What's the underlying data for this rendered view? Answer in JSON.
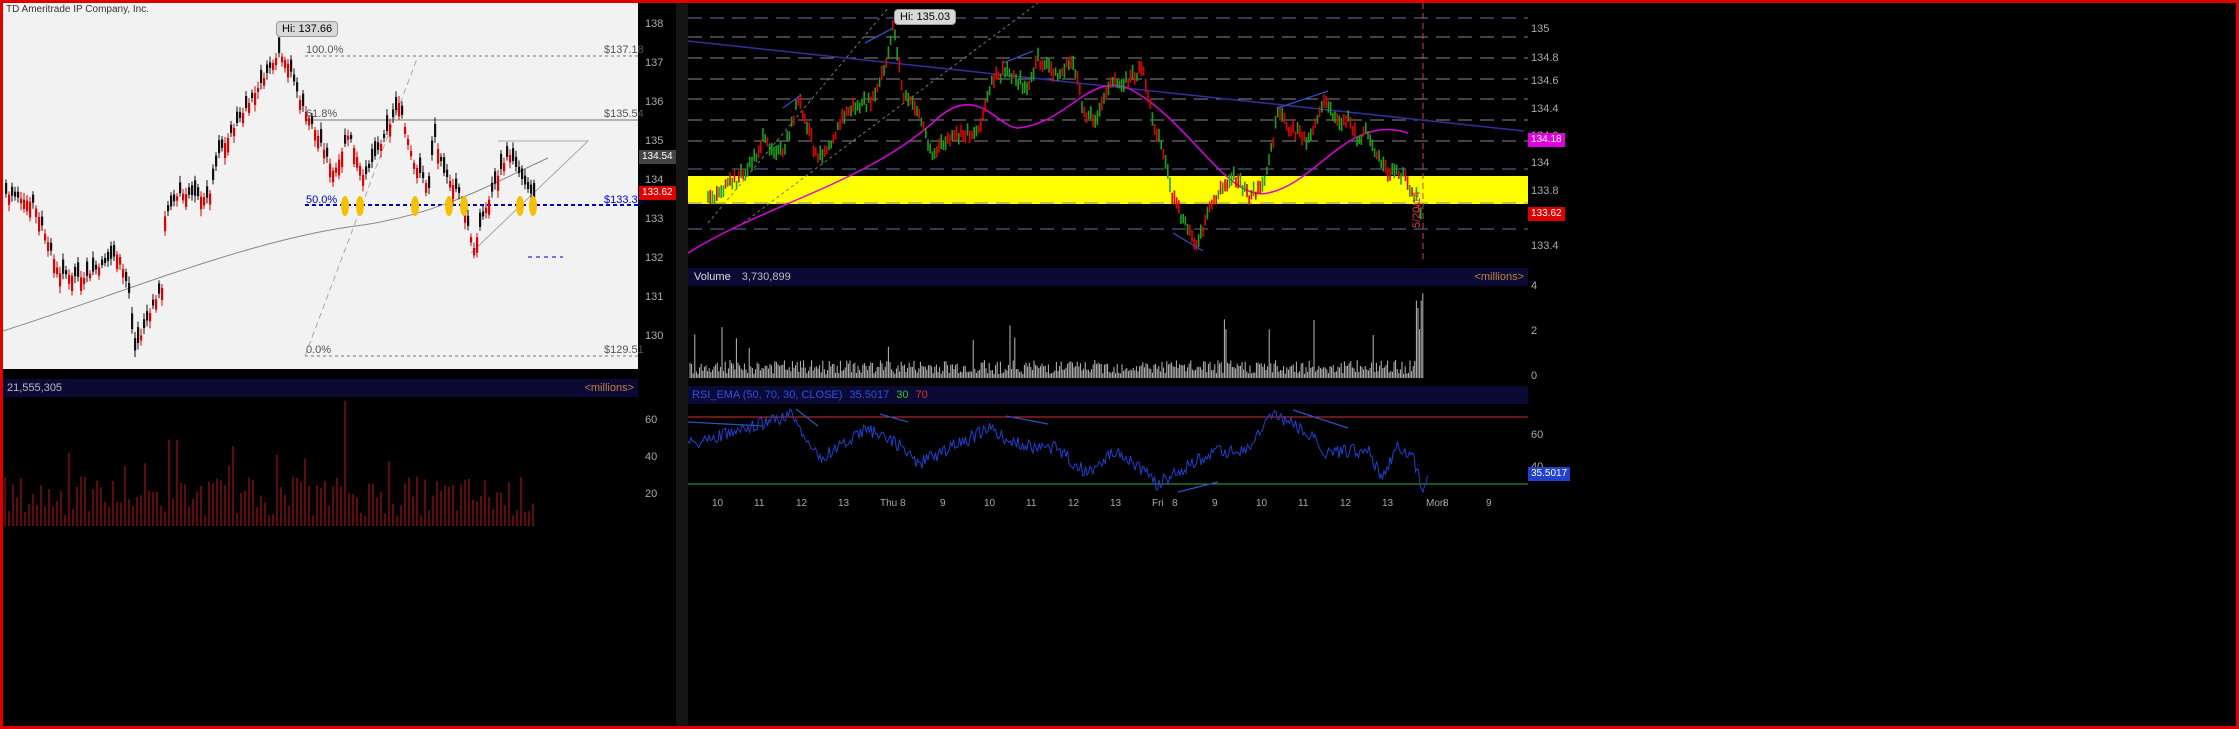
{
  "left_chart": {
    "company": "TD Ameritrade IP Company, Inc.",
    "hi_label": "Hi: 137.66",
    "price_axis": [
      "138",
      "137",
      "136",
      "135",
      "134",
      "133",
      "132",
      "131",
      "130"
    ],
    "current_price_tag": "134.54",
    "low_price_tag": "133.62",
    "fib_levels": [
      {
        "pct": "100.0%",
        "price": "$137.18"
      },
      {
        "pct": "61.8%",
        "price": "$135.54"
      },
      {
        "pct": "50.0%",
        "price": "$133.35"
      },
      {
        "pct": "0.0%",
        "price": "$129.51"
      }
    ],
    "volume_header": "21,555,305",
    "volume_units": "<millions>",
    "volume_axis": [
      "60",
      "40",
      "20"
    ],
    "colors": {
      "up": "#111111",
      "down": "#e00000",
      "fib_dash": "#0000cc",
      "marker": "#f5c000"
    }
  },
  "right_chart": {
    "hi_label": "Hi: 135.03",
    "price_axis": [
      "135",
      "134.8",
      "134.6",
      "134.4",
      "134.2",
      "134",
      "133.8",
      "133.6",
      "133.4"
    ],
    "current_price_tag": "134.18",
    "low_price_tag": "133.62",
    "date_marker": "5/20/14",
    "volume_label": "Volume",
    "volume_value": "3,730,899",
    "volume_units": "<millions>",
    "volume_axis": [
      "4",
      "2",
      "0"
    ],
    "rsi_label": "RSI_EMA (50, 70, 30, CLOSE)",
    "rsi_value": "35.5017",
    "rsi_ob": "30",
    "rsi_os": "70",
    "rsi_axis": [
      "60",
      "40"
    ],
    "rsi_current_tag": "35.5017",
    "time_axis": [
      "10",
      "11",
      "12",
      "13",
      "Thu",
      "8",
      "9",
      "10",
      "11",
      "12",
      "13",
      "Fri",
      "8",
      "9",
      "10",
      "11",
      "12",
      "13",
      "Mon",
      "8",
      "9"
    ],
    "colors": {
      "up": "#1aa01a",
      "down": "#e00000",
      "band": "#ffff00",
      "ma": "#e000e0",
      "trend": "#3030a0",
      "rsi": "#2040d0"
    }
  }
}
